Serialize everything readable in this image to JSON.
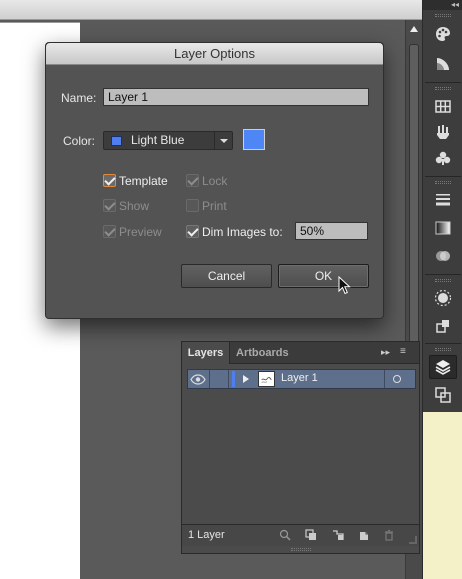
{
  "dialog": {
    "title": "Layer Options",
    "name_label": "Name:",
    "name_value": "Layer 1",
    "color_label": "Color:",
    "color_value": "Light Blue",
    "color_hex": "#4f86f5",
    "options": {
      "template": {
        "label": "Template",
        "checked": true,
        "enabled": true
      },
      "lock": {
        "label": "Lock",
        "checked": true,
        "enabled": false
      },
      "show": {
        "label": "Show",
        "checked": true,
        "enabled": false
      },
      "print": {
        "label": "Print",
        "checked": false,
        "enabled": false
      },
      "preview": {
        "label": "Preview",
        "checked": true,
        "enabled": false
      },
      "dim_images": {
        "label": "Dim Images to:",
        "checked": true,
        "enabled": true
      }
    },
    "dim_value": "50%",
    "cancel_label": "Cancel",
    "ok_label": "OK"
  },
  "layers_panel": {
    "tabs": [
      "Layers",
      "Artboards"
    ],
    "expand_icon": "▸▸",
    "menu_icon": "≡",
    "layers": [
      {
        "name": "Layer 1",
        "color": "#4f7ef0"
      }
    ],
    "count_label": "1 Layer"
  },
  "right_toolbar": {
    "collapse_icon": "◂◂",
    "icons": [
      "color-icon",
      "color-guide-icon",
      "swatches-icon",
      "brushes-icon",
      "symbols-icon",
      "stroke-icon",
      "gradient-icon",
      "transparency-icon",
      "appearance-icon",
      "graphic-styles-icon",
      "layers-icon",
      "artboards-icon"
    ]
  },
  "colors": {
    "panel_bg": "#535353",
    "accent_selected_row": "#5d6f8a"
  }
}
